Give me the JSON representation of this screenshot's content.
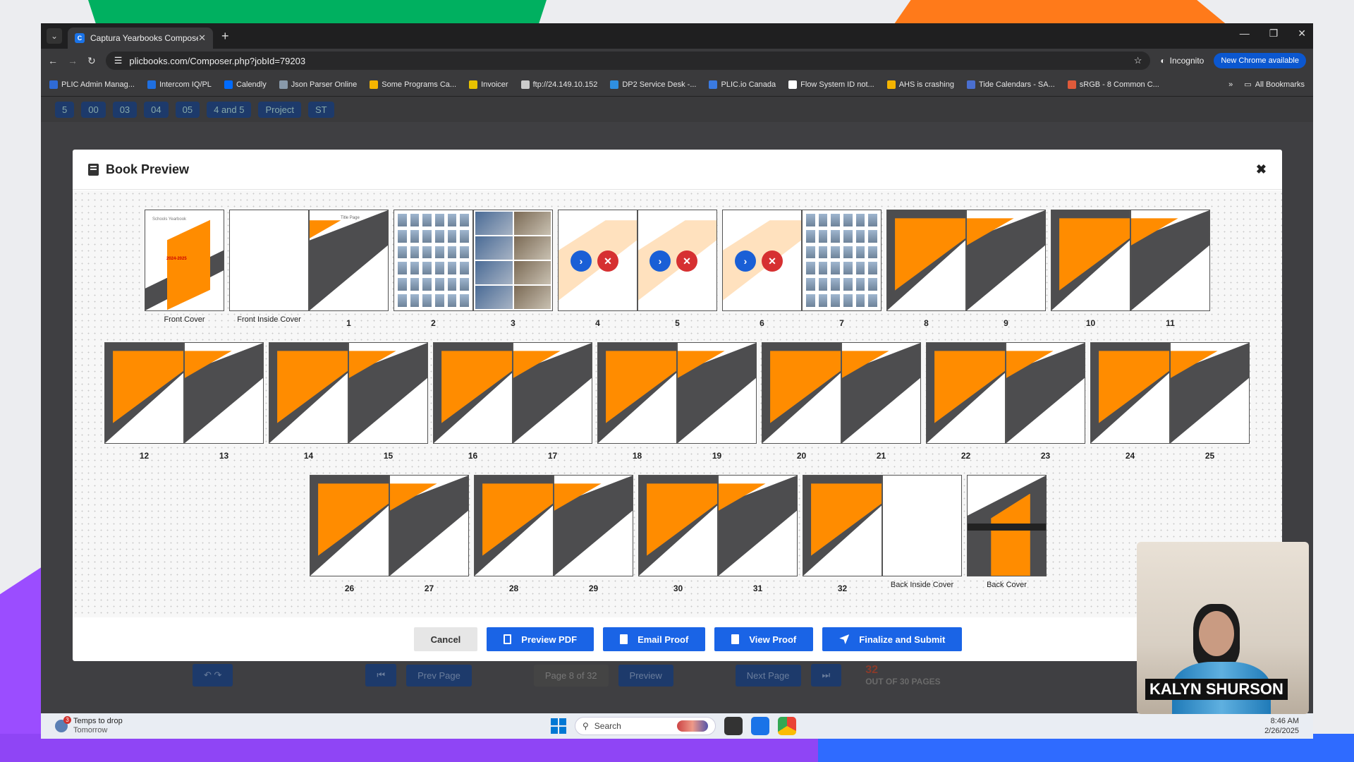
{
  "browser": {
    "tab_title": "Captura Yearbooks Composer",
    "url": "plicbooks.com/Composer.php?jobId=79203",
    "incognito_label": "Incognito",
    "new_chrome_label": "New Chrome available",
    "bookmarks": [
      {
        "label": "PLIC Admin Manag...",
        "color": "#2f6bd6"
      },
      {
        "label": "Intercom IQ/PL",
        "color": "#1f6fe0"
      },
      {
        "label": "Calendly",
        "color": "#006bff"
      },
      {
        "label": "Json Parser Online",
        "color": "#8899aa"
      },
      {
        "label": "Some Programs Ca...",
        "color": "#f4b400"
      },
      {
        "label": "Invoicer",
        "color": "#e8c200"
      },
      {
        "label": "ftp://24.149.10.152",
        "color": "#cccccc"
      },
      {
        "label": "DP2 Service Desk -...",
        "color": "#2f8fe0"
      },
      {
        "label": "PLIC.io Canada",
        "color": "#3a7ae0"
      },
      {
        "label": "Flow System ID not...",
        "color": "#ffffff"
      },
      {
        "label": "AHS is crashing",
        "color": "#f4b400"
      },
      {
        "label": "Tide Calendars - SA...",
        "color": "#4a6fd0"
      },
      {
        "label": "sRGB - 8 Common C...",
        "color": "#e05a3a"
      }
    ],
    "all_bookmarks_label": "All Bookmarks"
  },
  "app_behind": {
    "chips": [
      "5",
      "00",
      "03",
      "04",
      "05",
      "4 and 5",
      "Project",
      "ST"
    ],
    "prev_page": "Prev Page",
    "page_field": "Page 8 of 32",
    "preview": "Preview",
    "next_page": "Next Page",
    "page_count": "32",
    "out_of": "OUT OF 30 PAGES"
  },
  "modal": {
    "title": "Book Preview",
    "close_glyph": "✖",
    "tooltip": "04",
    "labels": {
      "front_cover": "Front Cover",
      "front_inside_cover": "Front Inside Cover",
      "back_inside_cover": "Back Inside Cover",
      "back_cover": "Back Cover"
    },
    "cover_title": "Schools Yearbook",
    "cover_year": "2024-2025",
    "fic_title": "Title Page",
    "page_numbers": [
      "1",
      "2",
      "3",
      "4",
      "5",
      "6",
      "7",
      "8",
      "9",
      "10",
      "11",
      "12",
      "13",
      "14",
      "15",
      "16",
      "17",
      "18",
      "19",
      "20",
      "21",
      "22",
      "23",
      "24",
      "25",
      "26",
      "27",
      "28",
      "29",
      "30",
      "31",
      "32"
    ],
    "buttons": {
      "cancel": "Cancel",
      "preview_pdf": "Preview PDF",
      "email_proof": "Email Proof",
      "view_proof": "View Proof",
      "finalize": "Finalize and Submit"
    },
    "accent_color": "#ff8c00",
    "primary_color": "#1a64e6"
  },
  "taskbar": {
    "weather_title": "Temps to drop",
    "weather_sub": "Tomorrow",
    "weather_badge": "3",
    "search_placeholder": "Search",
    "time": "8:46 AM",
    "date": "2/26/2025"
  },
  "webcam": {
    "name": "KALYN SHURSON"
  }
}
